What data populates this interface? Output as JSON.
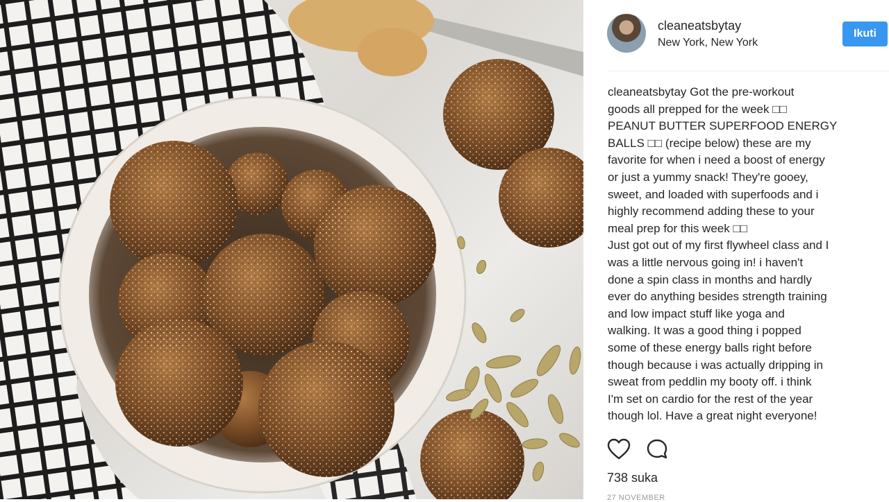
{
  "post": {
    "username": "cleaneatsbytay",
    "location": "New York, New York",
    "follow_label": "Ikuti",
    "caption_user": "cleaneatsbytay",
    "caption_lines": [
      "Got the pre-workout",
      "goods all prepped for the week □□",
      "PEANUT BUTTER SUPERFOOD ENERGY",
      "BALLS □□ (recipe below) these are my",
      "favorite for when i need a boost of energy",
      "or just a yummy snack! They're gooey,",
      "sweet, and loaded with superfoods and i",
      "highly recommend adding these to your",
      "meal prep for this week □□",
      "Just got out of my first flywheel class and I",
      "was a little nervous going in! i haven't",
      "done a spin class in months and hardly",
      "ever do anything besides strength training",
      "and low impact stuff like yoga and",
      "walking. It was a good thing i popped",
      "some of these energy balls right before",
      "though because i was actually dripping in",
      "sweat from peddlin my booty off. i think",
      "I'm set on cardio for the rest of the year",
      "though lol. Have a great night everyone!"
    ],
    "likes": "738 suka",
    "date": "27 NOVEMBER"
  },
  "icons": {
    "like": "heart-icon",
    "comment": "comment-icon"
  },
  "colors": {
    "accent": "#3897f0",
    "text": "#262626"
  }
}
